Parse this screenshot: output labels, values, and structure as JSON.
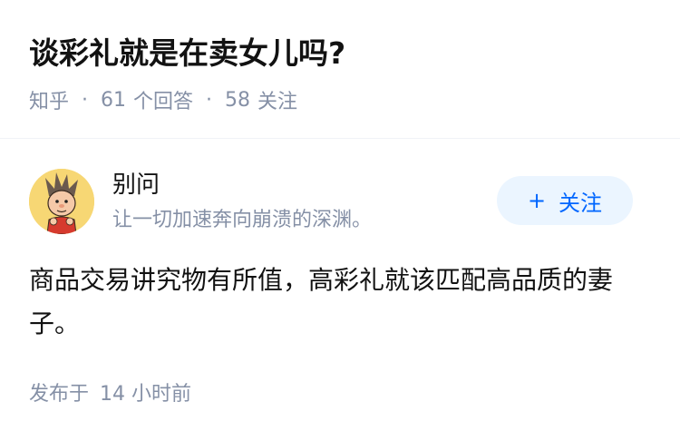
{
  "question": {
    "title": "谈彩礼就是在卖女儿吗?",
    "source": "知乎",
    "separator": "·",
    "answer_count": "61",
    "answer_label": "个回答",
    "follower_count": "58",
    "follower_label": "关注"
  },
  "answer": {
    "author": {
      "name": "别问",
      "bio": "让一切加速奔向崩溃的深渊。",
      "avatar_icon": "cartoon-avatar-icon"
    },
    "follow_button": {
      "icon": "+",
      "label": "关注"
    },
    "content": "商品交易讲究物有所值，高彩礼就该匹配高品质的妻子。",
    "posted_label": "发布于",
    "posted_time": "14 小时前"
  },
  "colors": {
    "accent": "#0066ff",
    "follow_bg": "#ebf5ff",
    "muted_text": "#8590a6",
    "main_text": "#121212",
    "divider": "#f0f2f7"
  }
}
